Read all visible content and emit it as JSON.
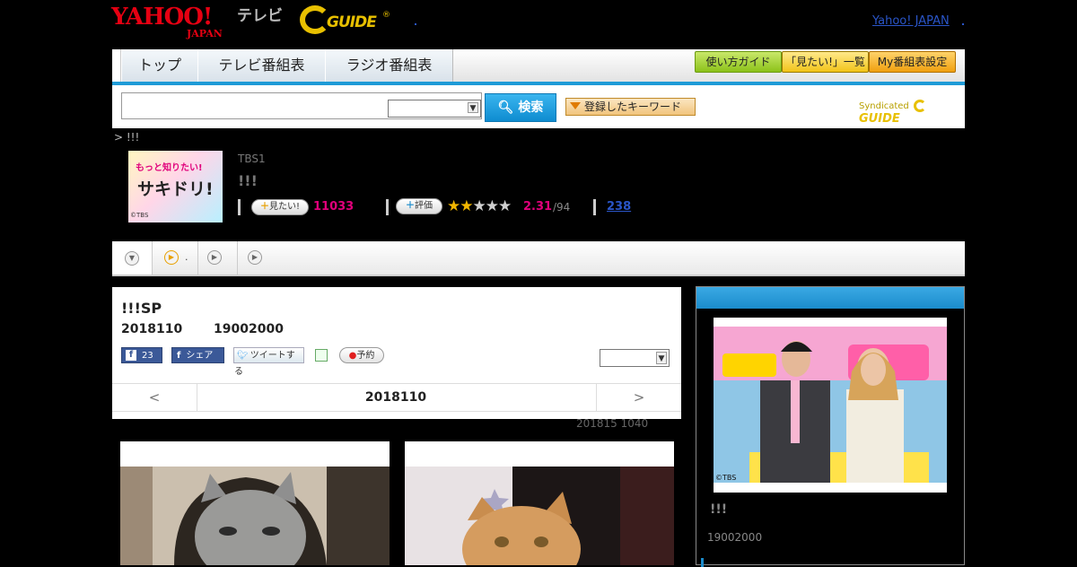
{
  "header": {
    "yahoo_logo": "YAHOO!",
    "yahoo_logo_sub": "JAPAN",
    "tv_label": "テレビ",
    "gguide_logo": "GUIDE",
    "yahoo_japan_link": "Yahoo! JAPAN"
  },
  "nav": {
    "tabs": [
      "トップ",
      "テレビ番組表",
      "ラジオ番組表"
    ],
    "buttons": [
      "使い方ガイド",
      "「見たい!」一覧",
      "My番組表設定"
    ]
  },
  "search": {
    "input_value": "",
    "select_value": "",
    "button_label": "検索",
    "keyword_button_label": "登録したキーワード",
    "syndicated_label": "Syndicated",
    "syndicated_logo": "GUIDE"
  },
  "breadcrumb": "> !!!",
  "program": {
    "thumb_text_a": "もっと知りたい!",
    "thumb_text_b": "サキドリ!",
    "thumb_credit": "©TBS",
    "channel": "TBS1",
    "title": "!!!",
    "want_label": "見たい!",
    "want_count": "11033",
    "rate_label": "評価",
    "stars_filled": 2,
    "stars_total": 5,
    "rating": "2.31",
    "rating_count": "/94",
    "review_count": "238"
  },
  "tabbar": {
    "tab2_label": "."
  },
  "main": {
    "title": "!!!SP",
    "date": "2018110",
    "time": "19002000",
    "fb_count": "23",
    "share_label": "シェア",
    "tweet_label": "ツイートする",
    "reserve_label": "予約",
    "select_value": "",
    "prev": "<",
    "date_nav": "2018110",
    "next": ">",
    "updated": "201815  1040"
  },
  "side": {
    "photo_credit": "©TBS",
    "title": "!!!",
    "time": "19002000"
  }
}
